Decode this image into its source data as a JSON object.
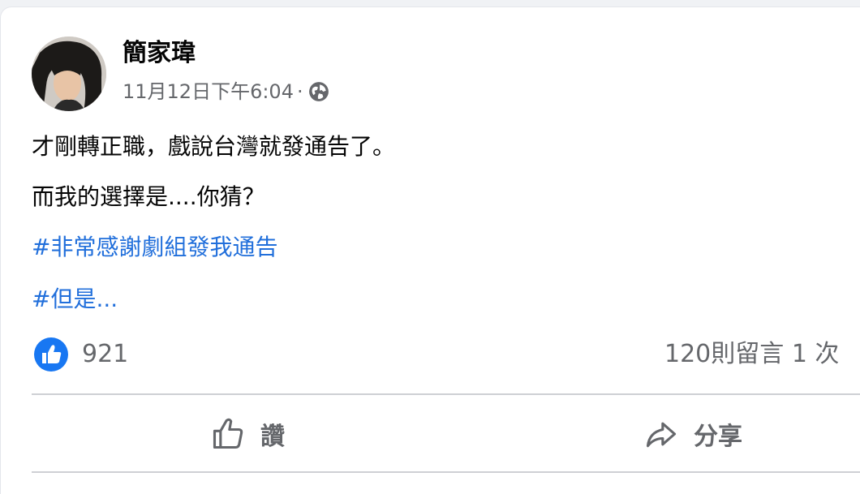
{
  "post": {
    "author": "簡家瑋",
    "timestamp": "11月12日下午6:04",
    "separator": "·",
    "privacy_icon": "globe-icon",
    "lines": [
      "才剛轉正職，戲說台灣就發通告了。",
      "而我的選擇是....你猜？"
    ],
    "hashtags": [
      "#非常感謝劇組發我通告",
      "#但是..."
    ]
  },
  "stats": {
    "like_icon": "thumbs-up-icon",
    "reactions": "921",
    "comments": "120則留言",
    "shares": "1 次"
  },
  "actions": {
    "like_label": "讚",
    "share_label": "分享"
  },
  "colors": {
    "hashtag": "#216fdb",
    "like_blue": "#1877f2",
    "secondary_text": "#65676b",
    "background": "#f0f2f5"
  }
}
